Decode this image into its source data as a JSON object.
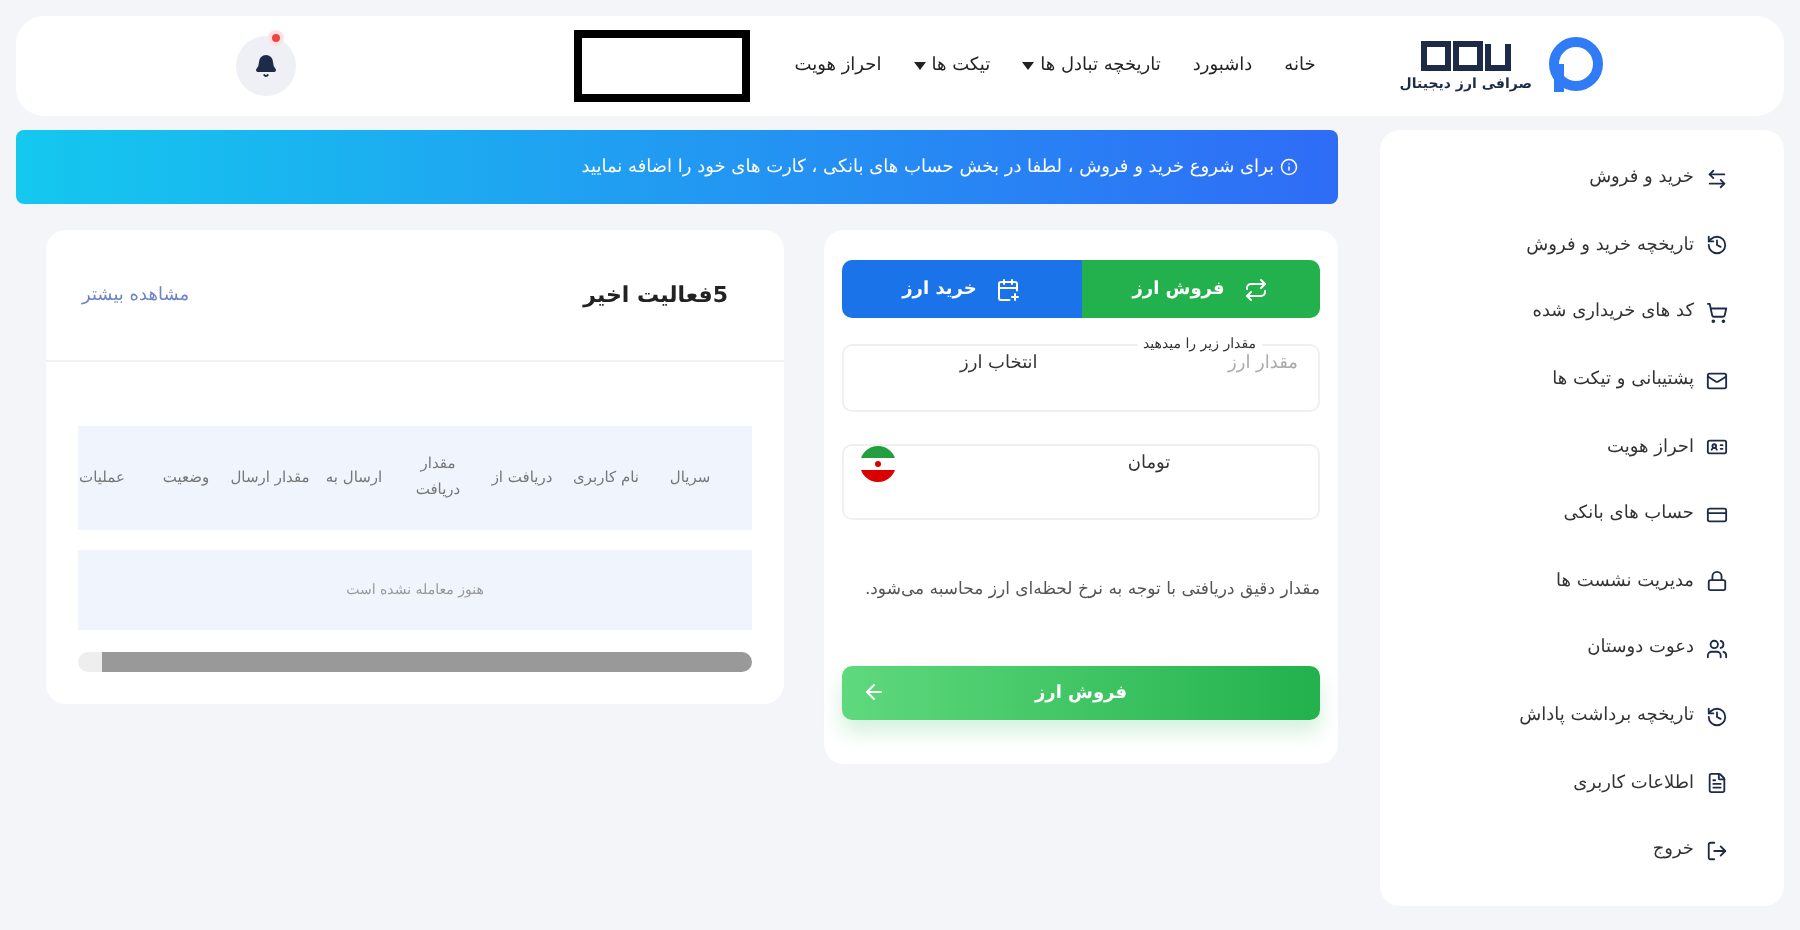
{
  "header": {
    "logo_caption": "صرافی ارز دیجیتال",
    "nav": [
      {
        "label": "خانه",
        "dropdown": false
      },
      {
        "label": "داشبورد",
        "dropdown": false
      },
      {
        "label": "تاریخچه تبادل ها",
        "dropdown": true
      },
      {
        "label": "تیکت ها",
        "dropdown": true
      },
      {
        "label": "احراز هویت",
        "dropdown": false
      }
    ],
    "notification_dot": true
  },
  "sidebar": {
    "items": [
      {
        "label": "خرید و فروش"
      },
      {
        "label": "تاریخچه خرید و فروش"
      },
      {
        "label": "کد های خریداری شده"
      },
      {
        "label": "پشتیبانی و تیکت ها"
      },
      {
        "label": "احراز هویت"
      },
      {
        "label": "حساب های بانکی"
      },
      {
        "label": "مدیریت نشست ها"
      },
      {
        "label": "دعوت دوستان"
      },
      {
        "label": "تاریخچه برداشت پاداش"
      },
      {
        "label": "اطلاعات کاربری"
      },
      {
        "label": "خروج"
      }
    ]
  },
  "alert": "برای شروع خرید و فروش ، لطفا در بخش حساب های بانکی ، کارت های خود را اضافه نمایید",
  "exchange": {
    "tabs": [
      {
        "label": "فروش ارز",
        "selected": true
      },
      {
        "label": "خرید ارز",
        "selected": false
      }
    ],
    "pay_field": {
      "label": "مقدار زیر را میدهید",
      "placeholder": "مقدار ارز",
      "select": "انتخاب ارز"
    },
    "receive_field": {
      "select": "تومان"
    },
    "note": "مقدار دقیق دریافتی با توجه به نرخ لحظه‌ای ارز محاسبه می‌شود.",
    "submit": "فروش ارز"
  },
  "activity": {
    "title": "5فعالیت اخیر",
    "more_link": "مشاهده بیشتر",
    "table": {
      "columns": [
        "سریال",
        "نام کاربری",
        "دریافت از",
        "مقدار دریافت",
        "ارسال به",
        "مقدار ارسال",
        "وضعیت",
        "عملیات"
      ],
      "empty": "هنوز معامله نشده است"
    }
  }
}
